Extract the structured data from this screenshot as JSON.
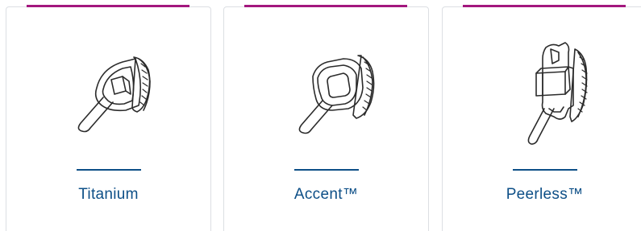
{
  "brand_colors": {
    "accent": "#a3177e",
    "title": "#0d4f87",
    "line_art": "#2b2b2b"
  },
  "cards": [
    {
      "name": "Titanium",
      "icon": "titanium-bracket-icon"
    },
    {
      "name": "Accent™",
      "icon": "accent-bracket-icon"
    },
    {
      "name": "Peerless™",
      "icon": "peerless-bracket-icon"
    }
  ]
}
